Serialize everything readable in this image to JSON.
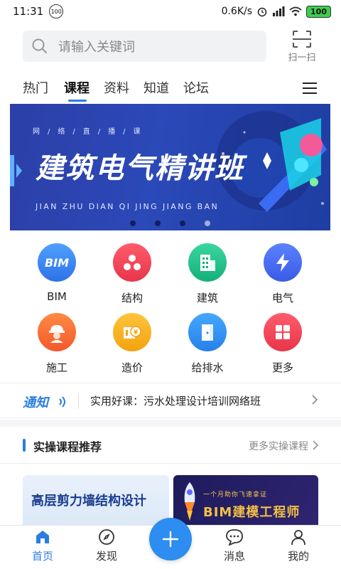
{
  "status_bar": {
    "time": "11:31",
    "badge": "100",
    "network_speed": "0.6K/s",
    "battery": "100"
  },
  "search": {
    "placeholder": "请输入关键词",
    "scan_label": "扫一扫"
  },
  "tabs": [
    {
      "label": "热门",
      "active": false
    },
    {
      "label": "课程",
      "active": true
    },
    {
      "label": "资料",
      "active": false
    },
    {
      "label": "知道",
      "active": false
    },
    {
      "label": "论坛",
      "active": false
    }
  ],
  "banner": {
    "tagline": "网/络/直/播/课",
    "title": "建筑电气精讲班",
    "pinyin": "JIAN ZHU DIAN QI JING JIANG BAN",
    "dot_count": 4,
    "active_dot": 3
  },
  "categories": [
    {
      "label": "BIM",
      "icon": "bim-icon",
      "color": "#3a86ee"
    },
    {
      "label": "结构",
      "icon": "structure-icon",
      "color": "#f2485a"
    },
    {
      "label": "建筑",
      "icon": "building-icon",
      "color": "#22c08a"
    },
    {
      "label": "电气",
      "icon": "lightning-icon",
      "color": "#4a6ef0"
    },
    {
      "label": "施工",
      "icon": "worker-icon",
      "color": "#ff6a33"
    },
    {
      "label": "造价",
      "icon": "price-icon",
      "color": "#f9b31f"
    },
    {
      "label": "给排水",
      "icon": "door-icon",
      "color": "#2d8df0"
    },
    {
      "label": "更多",
      "icon": "grid-icon",
      "color": "#f2485a"
    }
  ],
  "notice": {
    "logo": "通知",
    "text": "实用好课：污水处理设计培训网络班"
  },
  "section": {
    "title": "实操课程推荐",
    "more": "更多实操课程"
  },
  "cards": [
    {
      "title": "高层剪力墙结构设计"
    },
    {
      "subtitle": "一个月助你飞速拿证",
      "title": "BIM建模工程师"
    }
  ],
  "bottom_nav": [
    {
      "label": "首页",
      "active": true
    },
    {
      "label": "发现",
      "active": false
    },
    {
      "label": "消息",
      "active": false
    },
    {
      "label": "我的",
      "active": false
    }
  ],
  "colors": {
    "accent": "#2a7de1",
    "banner_bg": "#2b49b8"
  }
}
